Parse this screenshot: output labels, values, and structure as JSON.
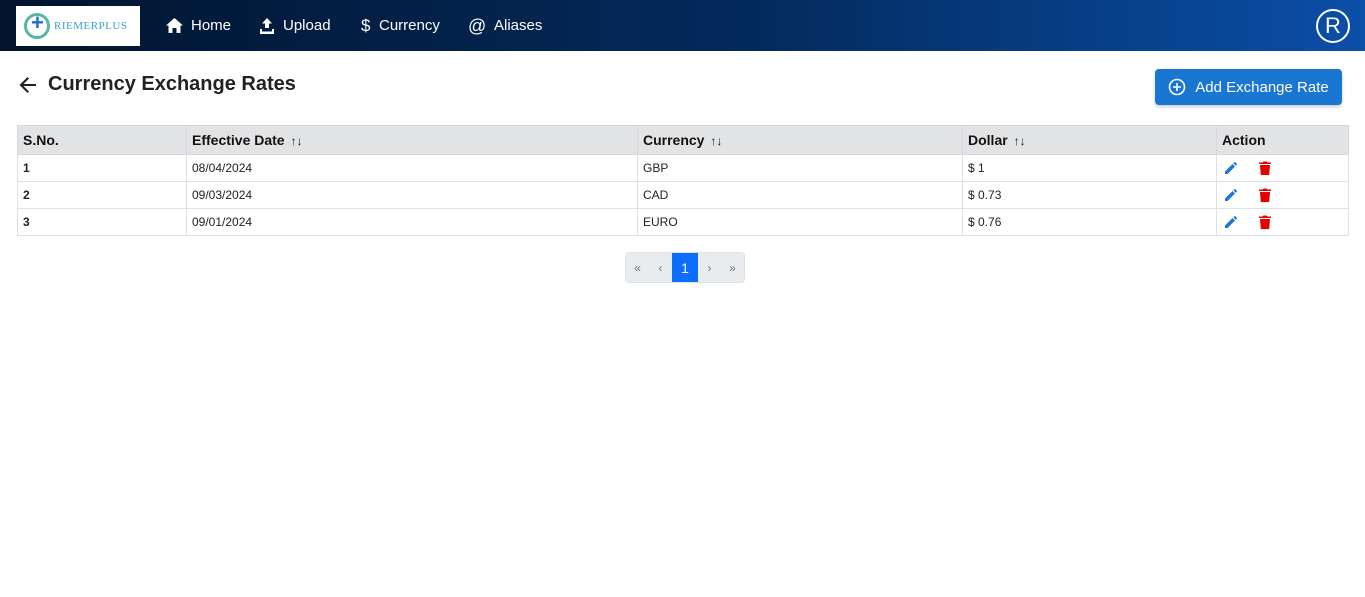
{
  "nav": {
    "logo_text": "RIEMERPLUS",
    "items": [
      {
        "label": "Home",
        "icon": "home-icon"
      },
      {
        "label": "Upload",
        "icon": "upload-icon"
      },
      {
        "label": "Currency",
        "icon": "dollar-icon"
      },
      {
        "label": "Aliases",
        "icon": "at-icon"
      }
    ],
    "avatar_letter": "R"
  },
  "page": {
    "title": "Currency Exchange Rates",
    "add_button_label": "Add Exchange Rate"
  },
  "table": {
    "headers": [
      "S.No.",
      "Effective Date",
      "Currency",
      "Dollar",
      "Action"
    ],
    "sort_glyph": "↑↓",
    "rows": [
      {
        "sno": "1",
        "date": "08/04/2024",
        "currency": "GBP",
        "dollar": "$ 1"
      },
      {
        "sno": "2",
        "date": "09/03/2024",
        "currency": "CAD",
        "dollar": "$ 0.73"
      },
      {
        "sno": "3",
        "date": "09/01/2024",
        "currency": "EURO",
        "dollar": "$ 0.76"
      }
    ]
  },
  "pagination": {
    "first": "«",
    "prev": "‹",
    "current": "1",
    "next": "›",
    "last": "»"
  },
  "colors": {
    "primary": "#1976d2",
    "edit": "#1976d2",
    "delete": "#e60000"
  }
}
